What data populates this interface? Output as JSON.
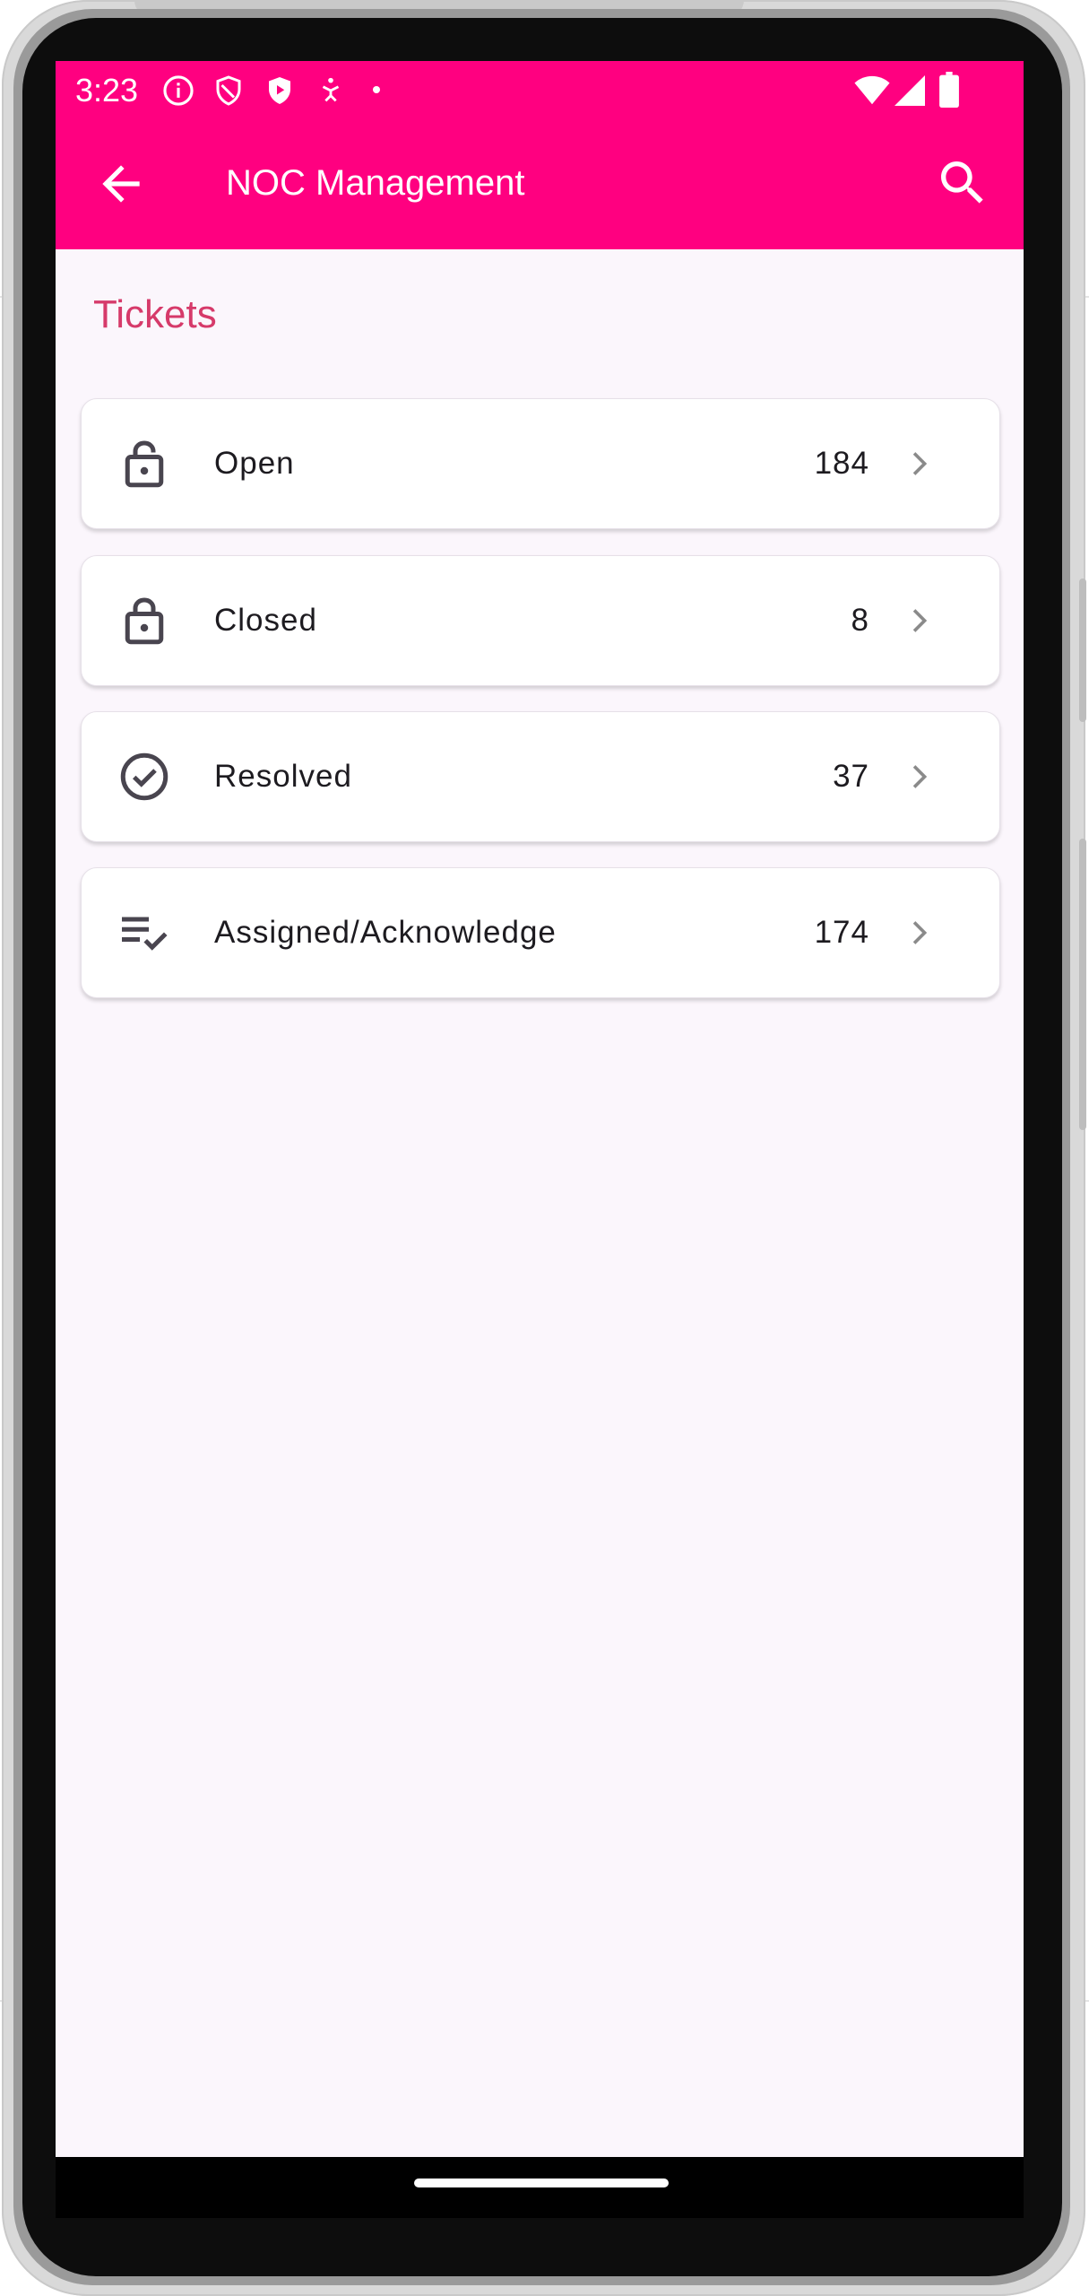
{
  "status_bar": {
    "time": "3:23",
    "left_icons": [
      "info-icon",
      "shield-icon",
      "play-shield-icon",
      "accessibility-icon",
      "dot-icon"
    ],
    "right_icons": [
      "wifi-icon",
      "signal-icon",
      "battery-icon"
    ]
  },
  "app_bar": {
    "title": "NOC Management",
    "back_icon": "arrow-back-icon",
    "search_icon": "search-icon",
    "color": "#ff0080"
  },
  "section": {
    "title": "Tickets",
    "title_color": "#d63a6a"
  },
  "tickets": [
    {
      "label": "Open",
      "count": "184",
      "icon": "lock-open-icon"
    },
    {
      "label": "Closed",
      "count": "8",
      "icon": "lock-closed-icon"
    },
    {
      "label": "Resolved",
      "count": "37",
      "icon": "check-circle-icon"
    },
    {
      "label": "Assigned/Acknowledge",
      "count": "174",
      "icon": "playlist-check-icon"
    }
  ]
}
